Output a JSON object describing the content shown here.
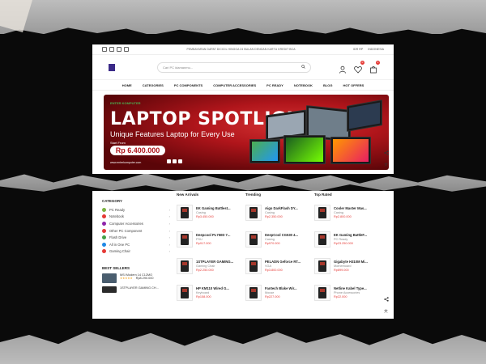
{
  "topbar": {
    "promo": "PEMBAYARAN DAPAT DICICIL HINGGA 24 BULAN DENGAN KARTU KREDIT BCA",
    "currency": "IDR RP",
    "language": "INDONESIA"
  },
  "search": {
    "placeholder": "Cari PC idamanmu..."
  },
  "header": {
    "wishlist_count": "0",
    "cart_count": "0"
  },
  "nav": [
    "HOME",
    "CATEGORIES",
    "PC COMPONENTS",
    "COMPUTER ACCESSORIES",
    "PC READY",
    "NOTEBOOK",
    "BLOG",
    "HOT OFFERS"
  ],
  "banner": {
    "brand": "ENTER KOMPUTER",
    "title": "LAPTOP SPOTLIGHT",
    "subtitle": "Unique Features Laptop for Every Use",
    "start_from": "Start From",
    "price": "Rp 6.400.000",
    "website": "www.enterkomputer.com",
    "social": "Instagram"
  },
  "sidebar": {
    "category_title": "CATEGORY",
    "categories": [
      {
        "label": "PC Ready",
        "color": "#7cb342"
      },
      {
        "label": "Notebook",
        "color": "#e53935"
      },
      {
        "label": "Computer Accessories",
        "color": "#8e24aa"
      },
      {
        "label": "Other PC Component",
        "color": "#e53935"
      },
      {
        "label": "Flash Drive",
        "color": "#43a047"
      },
      {
        "label": "All in One PC",
        "color": "#1e88e5"
      },
      {
        "label": "Gaming Chair",
        "color": "#e53935"
      }
    ],
    "best_sellers_title": "BEST SELLERS",
    "best_sellers": [
      {
        "name": "MSI Modern 14 C12MO",
        "rating": "★★★★★",
        "price": "Rp8.290.000"
      },
      {
        "name": "1STPLAYER GAMING CH..."
      }
    ]
  },
  "columns": [
    {
      "title": "New Arrivals",
      "products": [
        {
          "name": "EK Gaming Battlest...",
          "category": "Casing",
          "price": "Rp3.450.000"
        },
        {
          "name": "Deepcool PL750D 7...",
          "category": "PSU",
          "price": "Rp917.000"
        },
        {
          "name": "1STPLAYER GAMING...",
          "category": "Gaming Chair",
          "price": "Rp2.250.000"
        },
        {
          "name": "HP KM110 Wired G...",
          "category": "Keyboard",
          "price": "Rp158.000"
        }
      ]
    },
    {
      "title": "Trending",
      "products": [
        {
          "name": "Aigo DarkFlash DY...",
          "category": "Casing",
          "price": "Rp2.350.000"
        },
        {
          "name": "DeepCool CG530 4...",
          "category": "Casing",
          "price": "Rp970.000"
        },
        {
          "name": "PELADN Geforce RT...",
          "category": "VGA",
          "price": "Rp3.800.000"
        },
        {
          "name": "Fantech Blake Wir...",
          "category": "Mouse",
          "price": "Rp227.000"
        }
      ]
    },
    {
      "title": "Top Rated",
      "products": [
        {
          "name": "Cooler Master Mas...",
          "category": "Casing",
          "price": "Rp2.800.000"
        },
        {
          "name": "EK Gaming BattleF...",
          "category": "PC Ready",
          "price": "Rp23.250.000"
        },
        {
          "name": "Gigabyte H310M Mi...",
          "category": "Motherboard",
          "price": "Rp899.000"
        },
        {
          "name": "Netline Kabel Type...",
          "category": "Phone Accessories",
          "price": "Rp22.000"
        }
      ]
    }
  ]
}
